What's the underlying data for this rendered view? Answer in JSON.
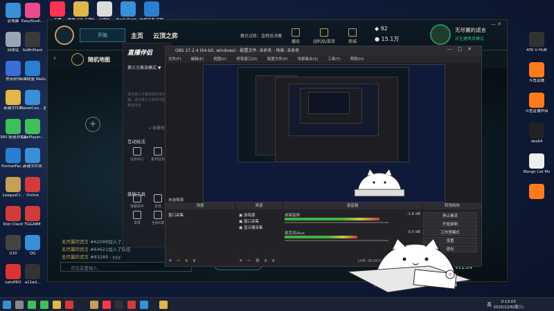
{
  "desktop": {
    "icons_left": [
      {
        "label": "此电脑",
        "color": "#3a8fd9"
      },
      {
        "label": "回收站",
        "color": "#9aa6b8"
      },
      {
        "label": "常用软件",
        "color": "#3a6fd9"
      },
      {
        "label": "新建文件夹",
        "color": "#e0b84a"
      },
      {
        "label": "360 极速浏览器",
        "color": "#3fbf5a"
      },
      {
        "label": "FormatFac...",
        "color": "#2a7fd0"
      },
      {
        "label": "LeagueCl...",
        "color": "#c8a054"
      },
      {
        "label": "Riot Client",
        "color": "#d13b3b"
      },
      {
        "label": "U10",
        "color": "#444"
      },
      {
        "label": "LetsPRO",
        "color": "#d33"
      }
    ],
    "icons_col2": [
      {
        "label": "EasyStudi...",
        "color": "#e84a8a"
      },
      {
        "label": "GoBrilliant",
        "color": "#3a3a3a"
      },
      {
        "label": "英雄联盟 WeGame",
        "color": "#2a7fd0"
      },
      {
        "label": "PlanetCoo... 图片方式",
        "color": "#3a8fd9"
      },
      {
        "label": "GeePlayer...",
        "color": "#3fbf5a"
      },
      {
        "label": "新建文件夹",
        "color": "#3a8fd9"
      },
      {
        "label": "Online",
        "color": "#d13b3b"
      },
      {
        "label": "TGGAME",
        "color": "#d13b3b"
      },
      {
        "label": "QQ",
        "color": "#3a8fd9"
      },
      {
        "label": "a11ad...",
        "color": "#333"
      }
    ],
    "icons_top": [
      {
        "label": "主播",
        "color": "#ff3355"
      },
      {
        "label": "截图飞出 主播伴侣",
        "color": "#e0b84a"
      },
      {
        "label": "小图标",
        "color": "#ddd"
      },
      {
        "label": "BaiduNetd...",
        "color": "#3a8fd9"
      },
      {
        "label": "新建文本 文档",
        "color": "#2a7fd0"
      }
    ],
    "icons_right": [
      {
        "label": "ATK V HUB",
        "color": "#333"
      },
      {
        "label": "斗鱼直播",
        "color": "#ff7a1a"
      },
      {
        "label": "斗鱼直播伴侣",
        "color": "#ff7a1a"
      },
      {
        "label": "obs64",
        "color": "#222"
      },
      {
        "label": "Bongo Cat Mver (2)",
        "color": "#eee"
      },
      {
        "label": "",
        "color": "#ff7a1a"
      }
    ],
    "clock_time": "0:13:03",
    "clock_date": "2025/12/6(周六)",
    "lang": "英"
  },
  "lol": {
    "play_button": "开始",
    "nav_home": "主页",
    "nav_tft": "云顶之弈",
    "nav_season": "赛光试炼：金辉总决赛",
    "nav_collection": "藏品",
    "nav_loot": "战利品/菜单",
    "nav_store": "商城",
    "currency_be": "92",
    "currency_rp": "15.1万",
    "summoner_name": "无尽翼的谎言",
    "status": "正在建筑待模式",
    "mode_title": "随机地图",
    "chat_lines": [
      {
        "name": "无尽翼的谎言",
        "text": "#62088加入了..."
      },
      {
        "name": "无尽翼的谎言",
        "text": "#64621加入了队伍"
      },
      {
        "name": "无尽翼的谎言",
        "text": "#83289 : yyy"
      }
    ],
    "chat_placeholder": "点击这里输入",
    "find_match": "寻找对局",
    "bottom_right": "V11.24"
  },
  "zbbl": {
    "logo": "直播伴侣",
    "mode": "第三方推流模式 ▼",
    "desc": "通过第三方推流软件进行直播，请在第三方软件中配置推流地址",
    "new_scene": "+ 新建场景",
    "section_interact": "互动玩法",
    "section_tools": "基础工具",
    "tools": [
      "任务中心",
      "素材任务",
      "弹幕助手",
      "音效",
      "录屏",
      "全民K歌"
    ]
  },
  "obs": {
    "title": "OBS 27.2.4 (64-bit, windows) - 配置文件: 未命名 - 场景: 未命名",
    "menu": [
      "文件(F)",
      "编辑(E)",
      "视图(V)",
      "停靠窗口(D)",
      "配置文件(P)",
      "场景集合(S)",
      "工具(T)",
      "帮助(H)"
    ],
    "docks": {
      "scenes": "场景",
      "sources": "来源",
      "mixer": "混音器",
      "transitions": "转场特效",
      "controls": "控件"
    },
    "scene_label": "未选择源",
    "scene_item": "窗口采集",
    "sources": [
      "游戏源",
      "窗口采集",
      "显示器采集"
    ],
    "mixer": [
      {
        "name": "桌面音频",
        "db": "-1.8 dB",
        "level": 0.72
      },
      {
        "name": "麦克风/Aux",
        "db": "0.0 dB",
        "level": 0.55
      }
    ],
    "controls": [
      "停止推流",
      "开始录制",
      "工作室模式",
      "设置",
      "退出"
    ],
    "status": "LIVE: 00:00:00  REC: 00:00:00  CPU: 8.4%, 60.00 fps"
  }
}
